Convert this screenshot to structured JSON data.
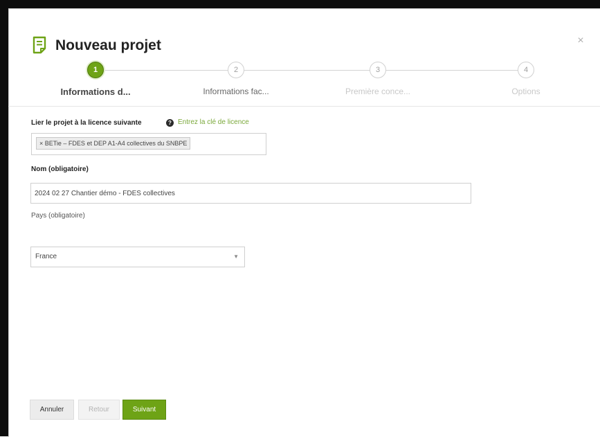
{
  "dialog": {
    "title": "Nouveau projet",
    "title_icon": "document-icon",
    "close_symbol": "×",
    "accent_color": "#6ea316"
  },
  "stepper": {
    "steps": [
      {
        "number": "1",
        "label": "Informations d...",
        "state": "active"
      },
      {
        "number": "2",
        "label": "Informations fac...",
        "state": "pending"
      },
      {
        "number": "3",
        "label": "Première conce...",
        "state": "disabled"
      },
      {
        "number": "4",
        "label": "Options",
        "state": "disabled"
      }
    ]
  },
  "license": {
    "label": "Lier le projet à la licence suivante",
    "help_icon": "question-circle-icon",
    "link_text": "Entrez la clé de licence",
    "selected_tag": "× BETie – FDES et DEP A1-A4 collectives du SNBPE"
  },
  "name_field": {
    "label": "Nom (obligatoire)",
    "value": "2024 02 27 Chantier démo - FDES collectives"
  },
  "country_field": {
    "label": "Pays (obligatoire)",
    "value": "France",
    "arrow_icon": "caret-down-icon"
  },
  "footer": {
    "cancel_label": "Annuler",
    "back_label": "Retour",
    "next_label": "Suivant"
  }
}
